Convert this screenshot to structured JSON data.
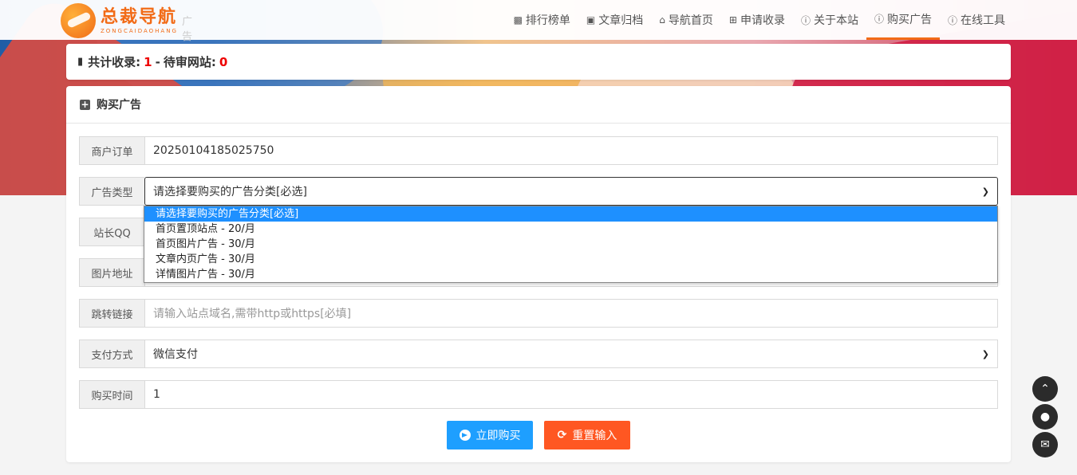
{
  "brand": {
    "name_cn": "总裁导航",
    "name_en": "ZONGCAIDAOHANG",
    "ghost_text": "广告"
  },
  "nav": {
    "items": [
      {
        "label": "排行榜单",
        "icon": "user-icon"
      },
      {
        "label": "文章归档",
        "icon": "contact-icon"
      },
      {
        "label": "导航首页",
        "icon": "home-icon"
      },
      {
        "label": "申请收录",
        "icon": "plus-square-icon"
      },
      {
        "label": "关于本站",
        "icon": "info-icon"
      },
      {
        "label": "购买广告",
        "icon": "info-icon",
        "active": true
      },
      {
        "label": "在线工具",
        "icon": "info-icon"
      }
    ]
  },
  "stats": {
    "total_label": "共计收录:",
    "total": "1",
    "sep": "-",
    "pending_label": "待审网站:",
    "pending": "0"
  },
  "form": {
    "title": "购买广告",
    "fields": {
      "order": {
        "label": "商户订单",
        "value": "20250104185025750"
      },
      "ad_type": {
        "label": "广告类型",
        "value": "请选择要购买的广告分类[必选]"
      },
      "qq": {
        "label": "站长QQ"
      },
      "image": {
        "label": "图片地址"
      },
      "link": {
        "label": "跳转链接",
        "placeholder": "请输入站点域名,需带http或https[必填]"
      },
      "pay": {
        "label": "支付方式",
        "value": "微信支付"
      },
      "time": {
        "label": "购买时间",
        "value": "1"
      }
    },
    "ad_type_options": [
      "请选择要购买的广告分类[必选]",
      "首页置顶站点 - 20/月",
      "首页图片广告 - 30/月",
      "文章内页广告 - 30/月",
      "详情图片广告 - 30/月"
    ],
    "buy_label": "立即购买",
    "reset_label": "重置输入"
  },
  "colors": {
    "accent": "#f26b17",
    "buy": "#1e9fff",
    "reset": "#ff5722",
    "highlight": "#1e90ff",
    "number": "#ee0000"
  }
}
